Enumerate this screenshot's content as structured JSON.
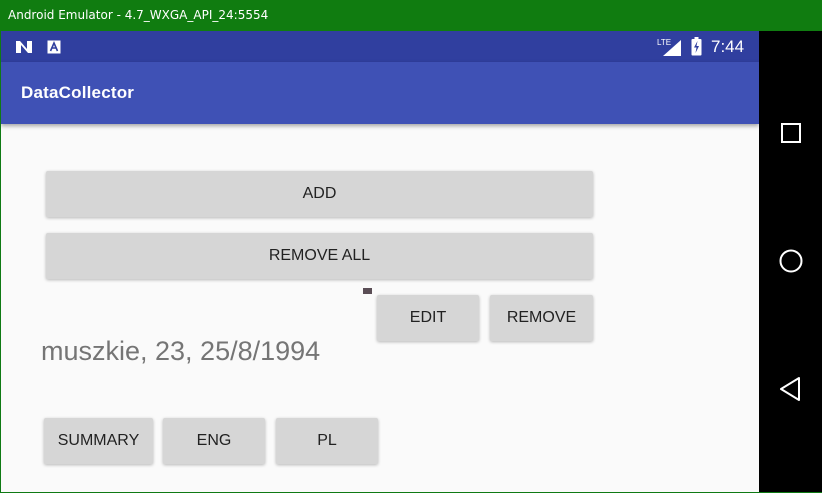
{
  "window": {
    "title": "Android Emulator - 4.7_WXGA_API_24:5554"
  },
  "status_bar": {
    "time": "7:44",
    "icons": [
      "notification-n-icon",
      "notification-a-icon",
      "lte-signal-icon",
      "battery-charging-icon"
    ],
    "colors": {
      "background": "#303f9f",
      "foreground": "#ffffff"
    }
  },
  "toolbar": {
    "title": "DataCollector",
    "color": "#3f51b5"
  },
  "buttons": {
    "add": "ADD",
    "remove_all": "REMOVE ALL",
    "edit": "EDIT",
    "remove": "REMOVE",
    "summary": "SUMMARY",
    "eng": "ENG",
    "pl": "PL"
  },
  "list": {
    "item": "muszkie, 23, 25/8/1994"
  },
  "nav_bar": {
    "icons": [
      "recents-square-icon",
      "home-circle-icon",
      "back-triangle-icon"
    ]
  }
}
